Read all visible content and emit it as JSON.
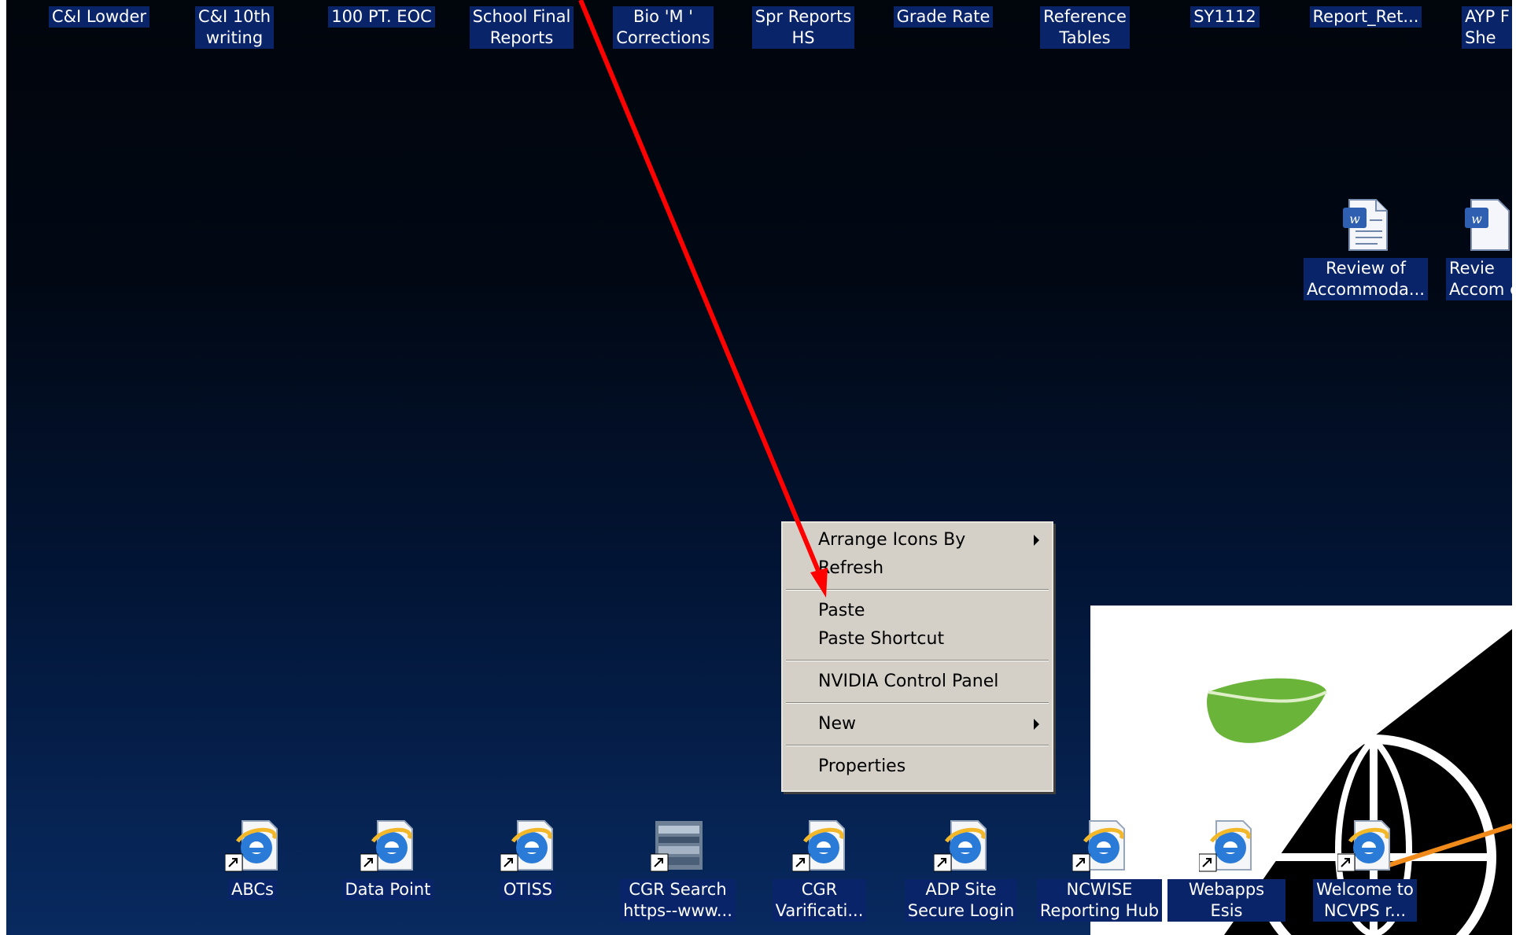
{
  "top_icons": [
    {
      "label": "C&I Lowder"
    },
    {
      "label": "C&I 10th\nwriting"
    },
    {
      "label": "100 PT. EOC"
    },
    {
      "label": "School Final\nReports"
    },
    {
      "label": "Bio 'M '\nCorrections"
    },
    {
      "label": "Spr Reports\nHS"
    },
    {
      "label": "Grade Rate"
    },
    {
      "label": "Reference\nTables"
    },
    {
      "label": "SY1112"
    },
    {
      "label": "Report_Ret..."
    },
    {
      "label": "AYP F\nShe"
    }
  ],
  "doc_icons": [
    {
      "label": "Review of\nAccommoda..."
    },
    {
      "label": "Revie\nAccom c"
    }
  ],
  "bottom_icons": [
    {
      "label": "ABCs"
    },
    {
      "label": "Data Point"
    },
    {
      "label": "OTISS"
    },
    {
      "label": "CGR Search\nhttps--www..."
    },
    {
      "label": "CGR\nVarificati..."
    },
    {
      "label": "ADP Site\nSecure Login"
    },
    {
      "label": "NCWISE\nReporting Hub"
    },
    {
      "label": "Webapps Esis"
    },
    {
      "label": "Welcome to\nNCVPS r..."
    }
  ],
  "context_menu": {
    "arrange": "Arrange Icons By",
    "refresh": "Refresh",
    "paste": "Paste",
    "paste_shortcut": "Paste Shortcut",
    "nvidia": "NVIDIA Control Panel",
    "new": "New",
    "properties": "Properties"
  },
  "annotation_arrow_color": "#ff0000",
  "selection_color": "#0a246a"
}
